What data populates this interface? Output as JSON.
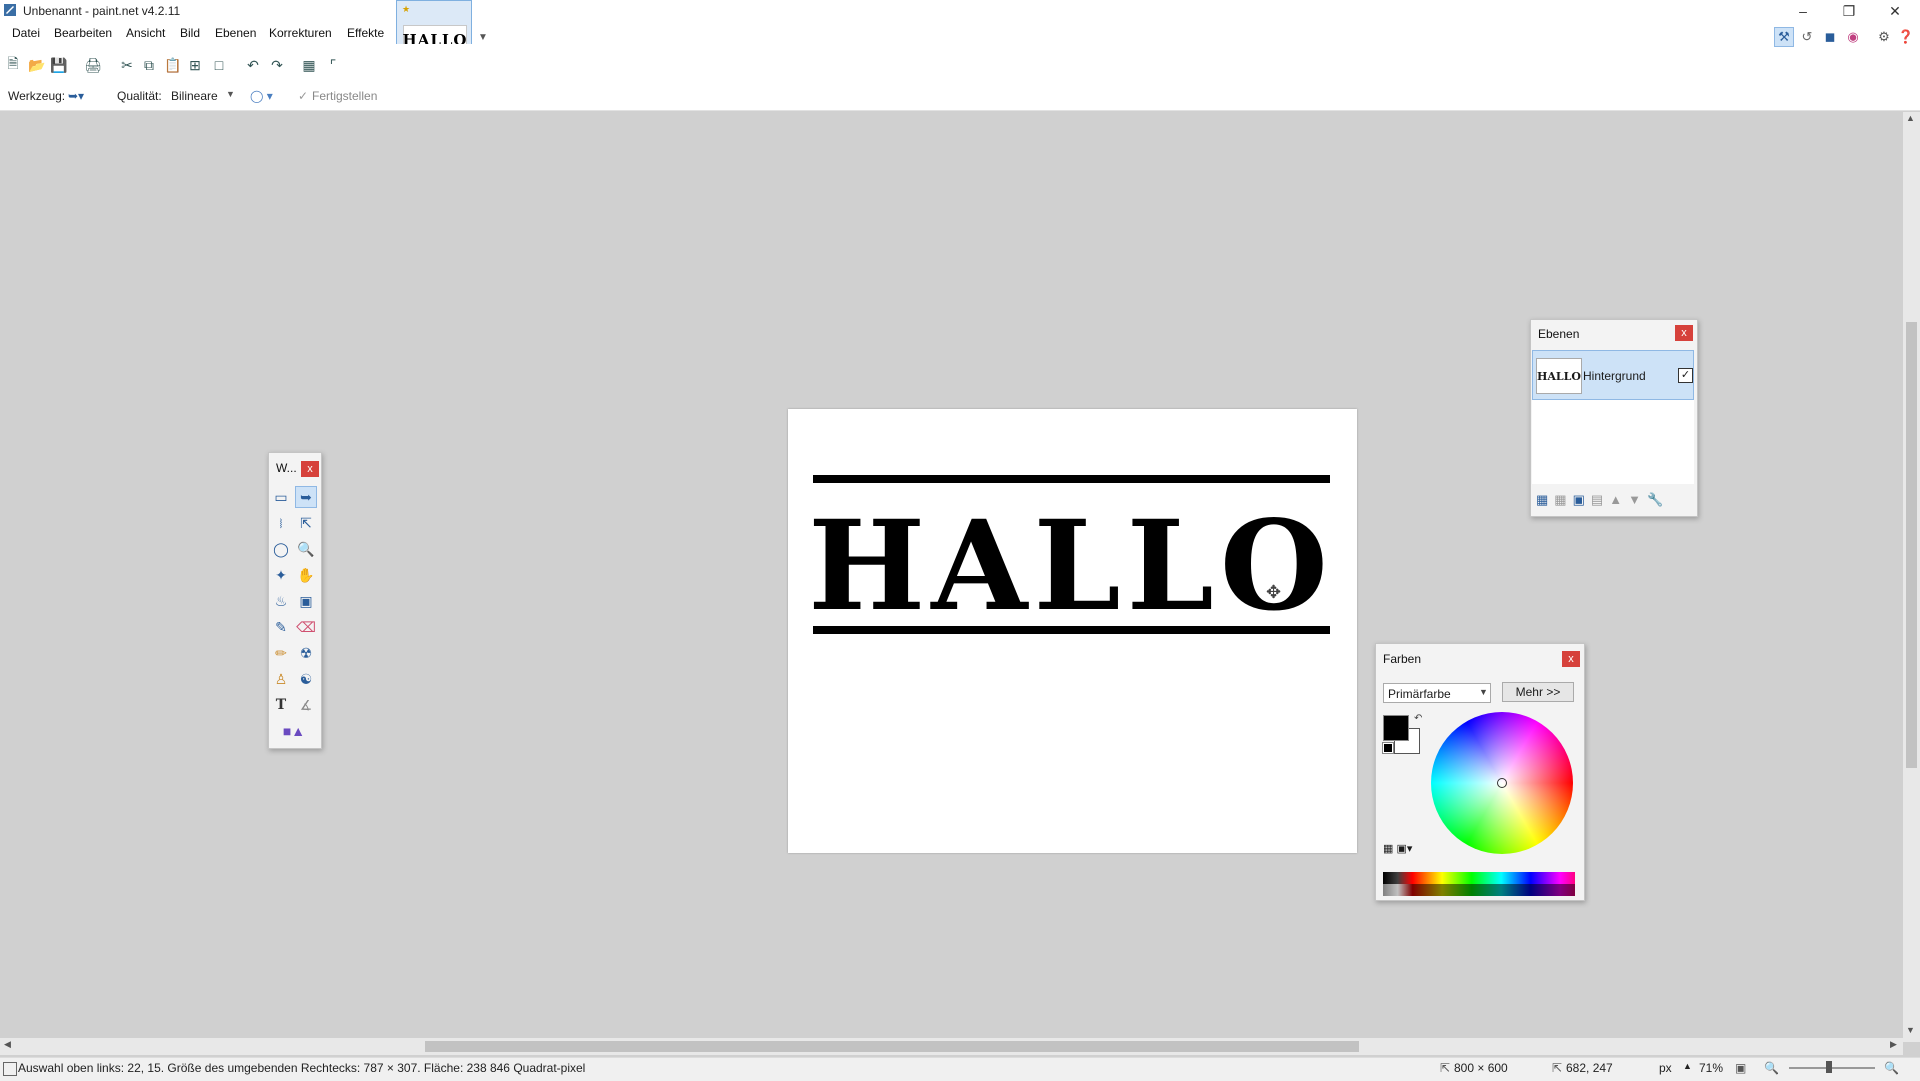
{
  "window": {
    "title": "Unbenannt - paint.net v4.2.11"
  },
  "menu": [
    "Datei",
    "Bearbeiten",
    "Ansicht",
    "Bild",
    "Ebenen",
    "Korrekturen",
    "Effekte"
  ],
  "doc_tab": {
    "thumb_text": "HALLO"
  },
  "options": {
    "tool_label": "Werkzeug:",
    "quality_label": "Qualität:",
    "quality_value": "Bilineare",
    "finish_label": "Fertigstellen"
  },
  "canvas": {
    "text": "HALLO"
  },
  "tools_palette": {
    "title": "W..."
  },
  "layers_palette": {
    "title": "Ebenen",
    "layers": [
      {
        "name": "Hintergrund",
        "thumb_text": "HALLO",
        "visible": true
      }
    ]
  },
  "colors_palette": {
    "title": "Farben",
    "mode": "Primärfarbe",
    "more_button": "Mehr >>",
    "primary": "#000000",
    "secondary": "#ffffff"
  },
  "status": {
    "selection_text": "Auswahl oben links: 22, 15. Größe des umgebenden Rechtecks: 787 × 307. Fläche: 238 846 Quadrat-pixel",
    "image_size": "800 × 600",
    "cursor_pos": "682, 247",
    "unit": "px",
    "zoom": "71%"
  },
  "colors": {
    "accent": "#0078d7",
    "close_red": "#d6413b",
    "workspace": "#d0d0d0"
  }
}
